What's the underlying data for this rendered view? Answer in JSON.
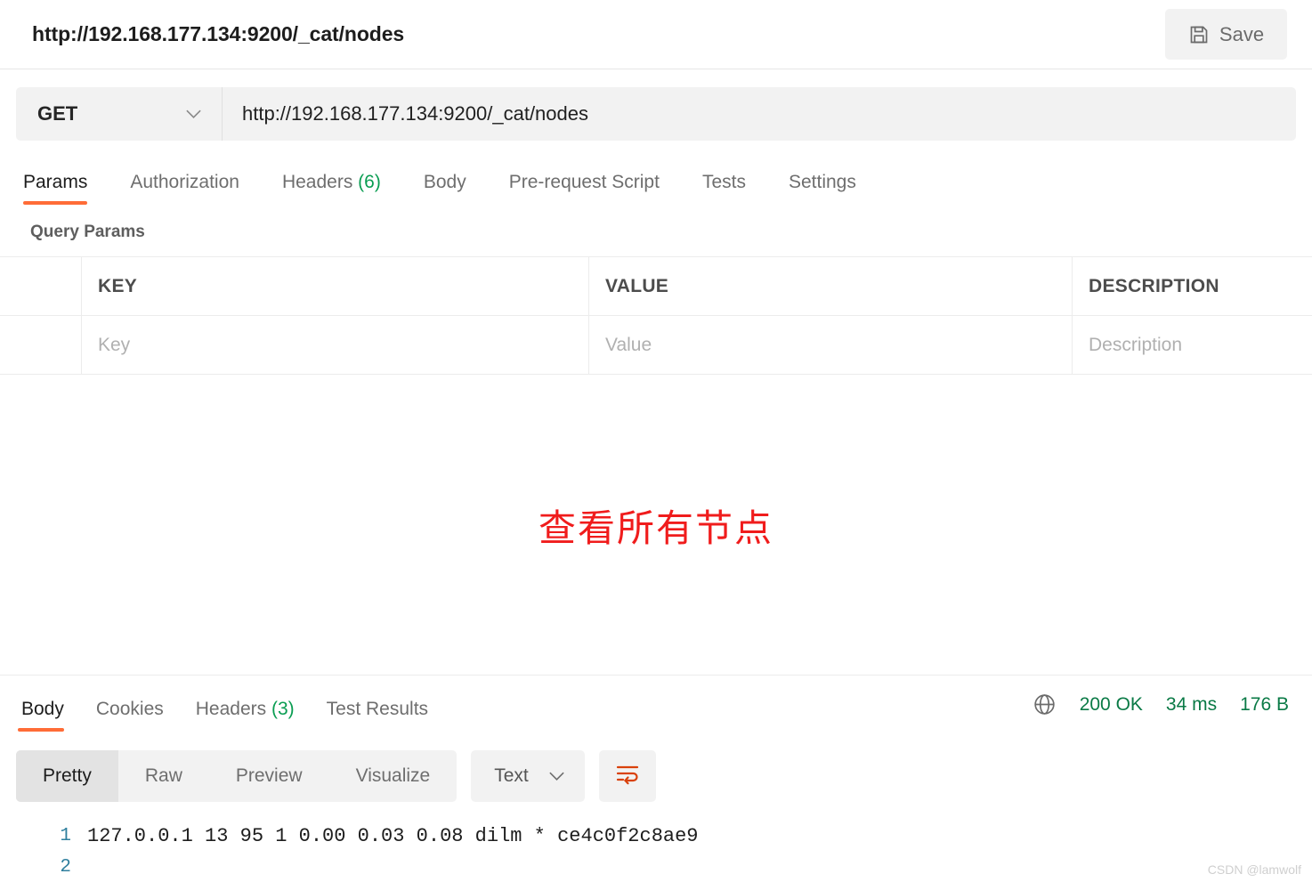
{
  "header": {
    "request_title": "http://192.168.177.134:9200/_cat/nodes",
    "save_label": "Save",
    "save_icon": "floppy-disk-icon"
  },
  "url_bar": {
    "method": "GET",
    "method_chevron_icon": "chevron-down-icon",
    "url": "http://192.168.177.134:9200/_cat/nodes"
  },
  "request_tabs": [
    {
      "label": "Params",
      "count": "",
      "active": true
    },
    {
      "label": "Authorization",
      "count": "",
      "active": false
    },
    {
      "label": "Headers",
      "count": "(6)",
      "active": false
    },
    {
      "label": "Body",
      "count": "",
      "active": false
    },
    {
      "label": "Pre-request Script",
      "count": "",
      "active": false
    },
    {
      "label": "Tests",
      "count": "",
      "active": false
    },
    {
      "label": "Settings",
      "count": "",
      "active": false
    }
  ],
  "query_params": {
    "title": "Query Params",
    "columns": [
      "KEY",
      "VALUE",
      "DESCRIPTION"
    ],
    "rows": [
      {
        "key_placeholder": "Key",
        "value_placeholder": "Value",
        "description_placeholder": "Description"
      }
    ]
  },
  "annotation": {
    "text": "查看所有节点",
    "color": "#f01c1c"
  },
  "response_tabs": [
    {
      "label": "Body",
      "count": "",
      "active": true
    },
    {
      "label": "Cookies",
      "count": "",
      "active": false
    },
    {
      "label": "Headers",
      "count": "(3)",
      "active": false
    },
    {
      "label": "Test Results",
      "count": "",
      "active": false
    }
  ],
  "response_status": {
    "globe_icon": "globe-icon",
    "status": "200 OK",
    "time": "34 ms",
    "size": "176 B",
    "color": "#0a7a46"
  },
  "format_bar": {
    "views": [
      {
        "label": "Pretty",
        "active": true
      },
      {
        "label": "Raw",
        "active": false
      },
      {
        "label": "Preview",
        "active": false
      },
      {
        "label": "Visualize",
        "active": false
      }
    ],
    "content_type": "Text",
    "content_type_chevron_icon": "chevron-down-icon",
    "wrap_icon": "word-wrap-icon",
    "wrap_icon_color": "#d9410b"
  },
  "response_body": {
    "lines": [
      {
        "number": "1",
        "text": "127.0.0.1 13 95 1 0.00 0.03 0.08 dilm * ce4c0f2c8ae9"
      },
      {
        "number": "2",
        "text": ""
      }
    ]
  },
  "watermark": "CSDN @lamwolf",
  "theme": {
    "accent": "#ff6c37",
    "green": "#0a9d52",
    "panel_gray": "#f2f2f2"
  }
}
